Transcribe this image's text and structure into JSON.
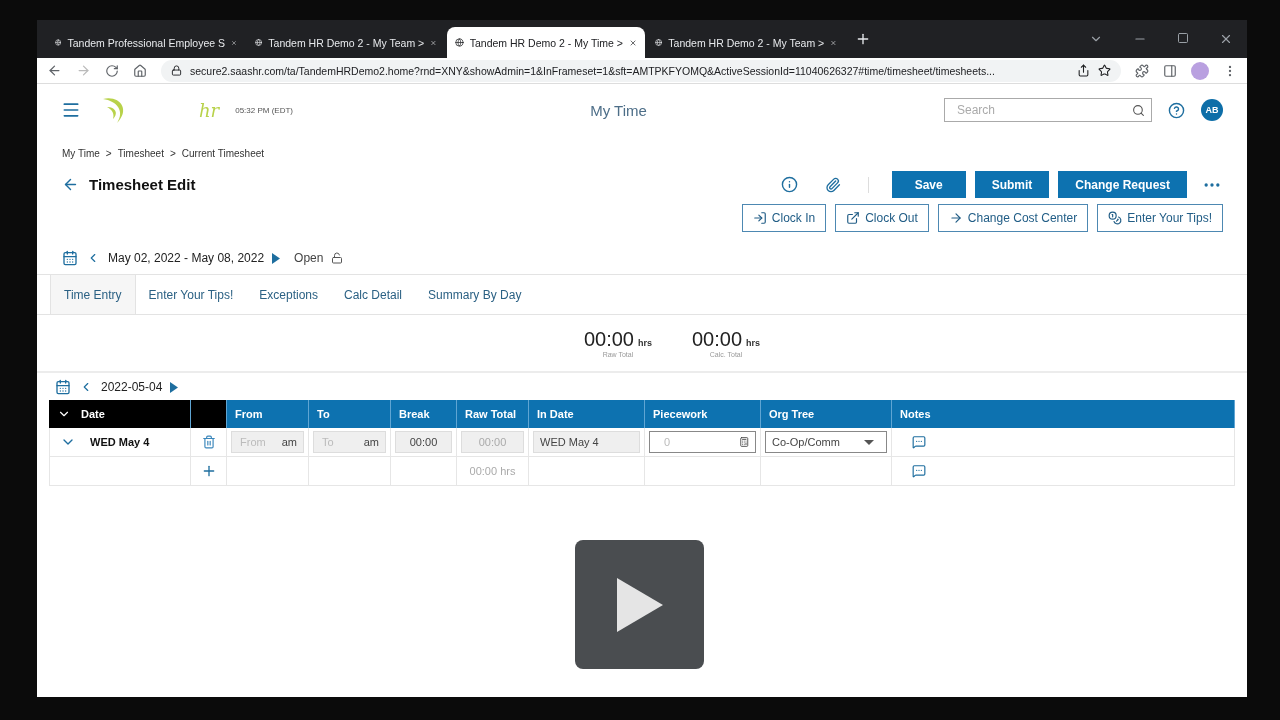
{
  "browser": {
    "tabs": [
      {
        "title": "Tandem Professional Employee S",
        "selected": false
      },
      {
        "title": "Tandem HR Demo 2 - My Team >",
        "selected": false
      },
      {
        "title": "Tandem HR Demo 2 - My Time >",
        "selected": true
      },
      {
        "title": "Tandem HR Demo 2 - My Team >",
        "selected": false
      }
    ],
    "url": "secure2.saashr.com/ta/TandemHRDemo2.home?rnd=XNY&showAdmin=1&InFrameset=1&sft=AMTPKFYOMQ&ActiveSessionId=11040626327#time/timesheet/timesheets..."
  },
  "header": {
    "logo_text": "hr",
    "time": "05:32 PM (EDT)",
    "title": "My Time",
    "search": {
      "placeholder": "Search"
    },
    "avatar": "AB"
  },
  "breadcrumb": {
    "separator": ">",
    "items": [
      "My Time",
      "Timesheet",
      "Current Timesheet"
    ]
  },
  "page_title": "Timesheet Edit",
  "primary_actions": [
    "Save",
    "Submit",
    "Change Request"
  ],
  "secondary_actions": [
    {
      "label": "Clock In",
      "kind": "clock-in"
    },
    {
      "label": "Clock Out",
      "kind": "clock-out"
    },
    {
      "label": "Change Cost Center",
      "kind": "arrow"
    },
    {
      "label": "Enter Your Tips!",
      "kind": "coins"
    }
  ],
  "period": {
    "range": "May 02, 2022 - May 08, 2022",
    "status": "Open",
    "locked": false
  },
  "tabs": [
    {
      "label": "Time Entry",
      "selected": true
    },
    {
      "label": "Enter Your Tips!",
      "selected": false
    },
    {
      "label": "Exceptions",
      "selected": false
    },
    {
      "label": "Calc Detail",
      "selected": false
    },
    {
      "label": "Summary By Day",
      "selected": false
    }
  ],
  "totals": [
    {
      "value": "00:00",
      "unit": "hrs",
      "label": "Raw Total"
    },
    {
      "value": "00:00",
      "unit": "hrs",
      "label": "Calc. Total"
    }
  ],
  "day_nav": {
    "date": "2022-05-04"
  },
  "grid": {
    "date_column": "Date",
    "columns": [
      "From",
      "To",
      "Break",
      "Raw Total",
      "In Date",
      "Piecework",
      "Org Tree",
      "Notes"
    ],
    "day": {
      "label": "WED May 4",
      "expanded": true
    },
    "entry": {
      "from": {
        "placeholder": "From",
        "suffix": "am"
      },
      "to": {
        "placeholder": "To",
        "suffix": "am"
      },
      "break": "00:00",
      "raw_total": "00:00",
      "in_date": "WED May 4",
      "piecework": {
        "placeholder": "0"
      },
      "org_tree": "Co-Op/Comm"
    },
    "day_total": "00:00 hrs"
  }
}
